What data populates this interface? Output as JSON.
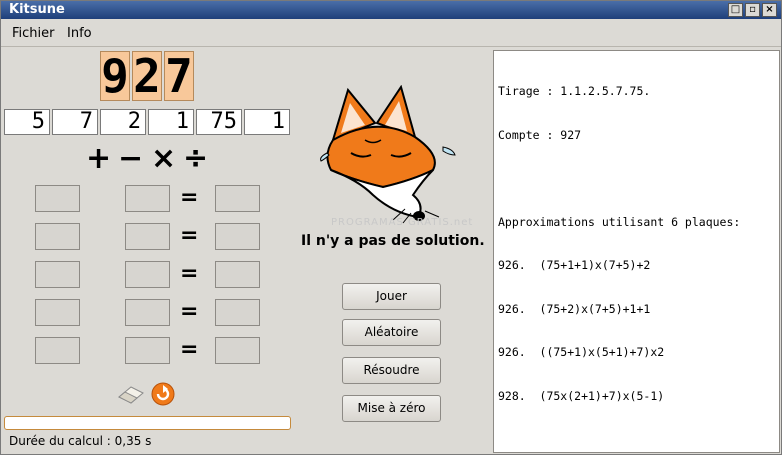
{
  "window": {
    "title": "Kitsune"
  },
  "menu": {
    "items": [
      "Fichier",
      "Info"
    ]
  },
  "target": {
    "digits": [
      "9",
      "2",
      "7"
    ]
  },
  "plates": [
    "5",
    "7",
    "2",
    "1",
    "75",
    "1"
  ],
  "operators": [
    "+",
    "−",
    "×",
    "÷"
  ],
  "equals_symbol": "=",
  "message": "Il n'y a pas de solution.",
  "buttons": {
    "play": "Jouer",
    "random": "Aléatoire",
    "solve": "Résoudre",
    "reset": "Mise à zéro"
  },
  "progress": {
    "fraction": 0.0
  },
  "duration": "Durée du calcul : 0,35 s",
  "results": {
    "lines": [
      "Tirage : 1.1.2.5.7.75.",
      "Compte : 927",
      "",
      "Approximations utilisant 6 plaques:",
      "926.  (75+1+1)x(7+5)+2",
      "926.  (75+2)x(7+5)+1+1",
      "926.  ((75+1)x(5+1)+7)x2",
      "928.  (75x(2+1)+7)x(5-1)"
    ]
  },
  "watermark": "PROGRAMAS GRATIS.net",
  "colors": {
    "accent": "#f8c89a",
    "fox": "#f07a1a"
  }
}
